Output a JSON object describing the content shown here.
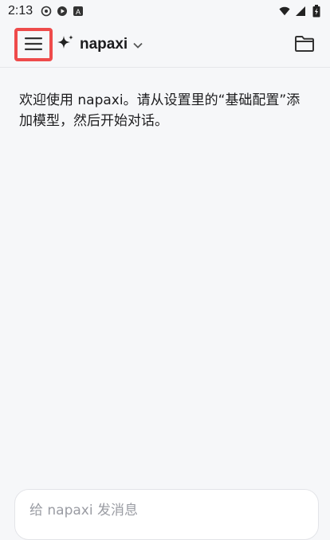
{
  "status_bar": {
    "time": "2:13",
    "icons_left": [
      "sync-icon",
      "play-icon",
      "a-icon"
    ],
    "icons_right": [
      "wifi-icon",
      "signal-icon",
      "battery-icon"
    ]
  },
  "app_bar": {
    "model_name": "napaxi",
    "accent_outline": "#ee4b4b"
  },
  "chat": {
    "welcome_text": "欢迎使用 napaxi。请从设置里的“基础配置”添加模型，然后开始对话。"
  },
  "composer": {
    "placeholder": "给 napaxi 发消息"
  }
}
